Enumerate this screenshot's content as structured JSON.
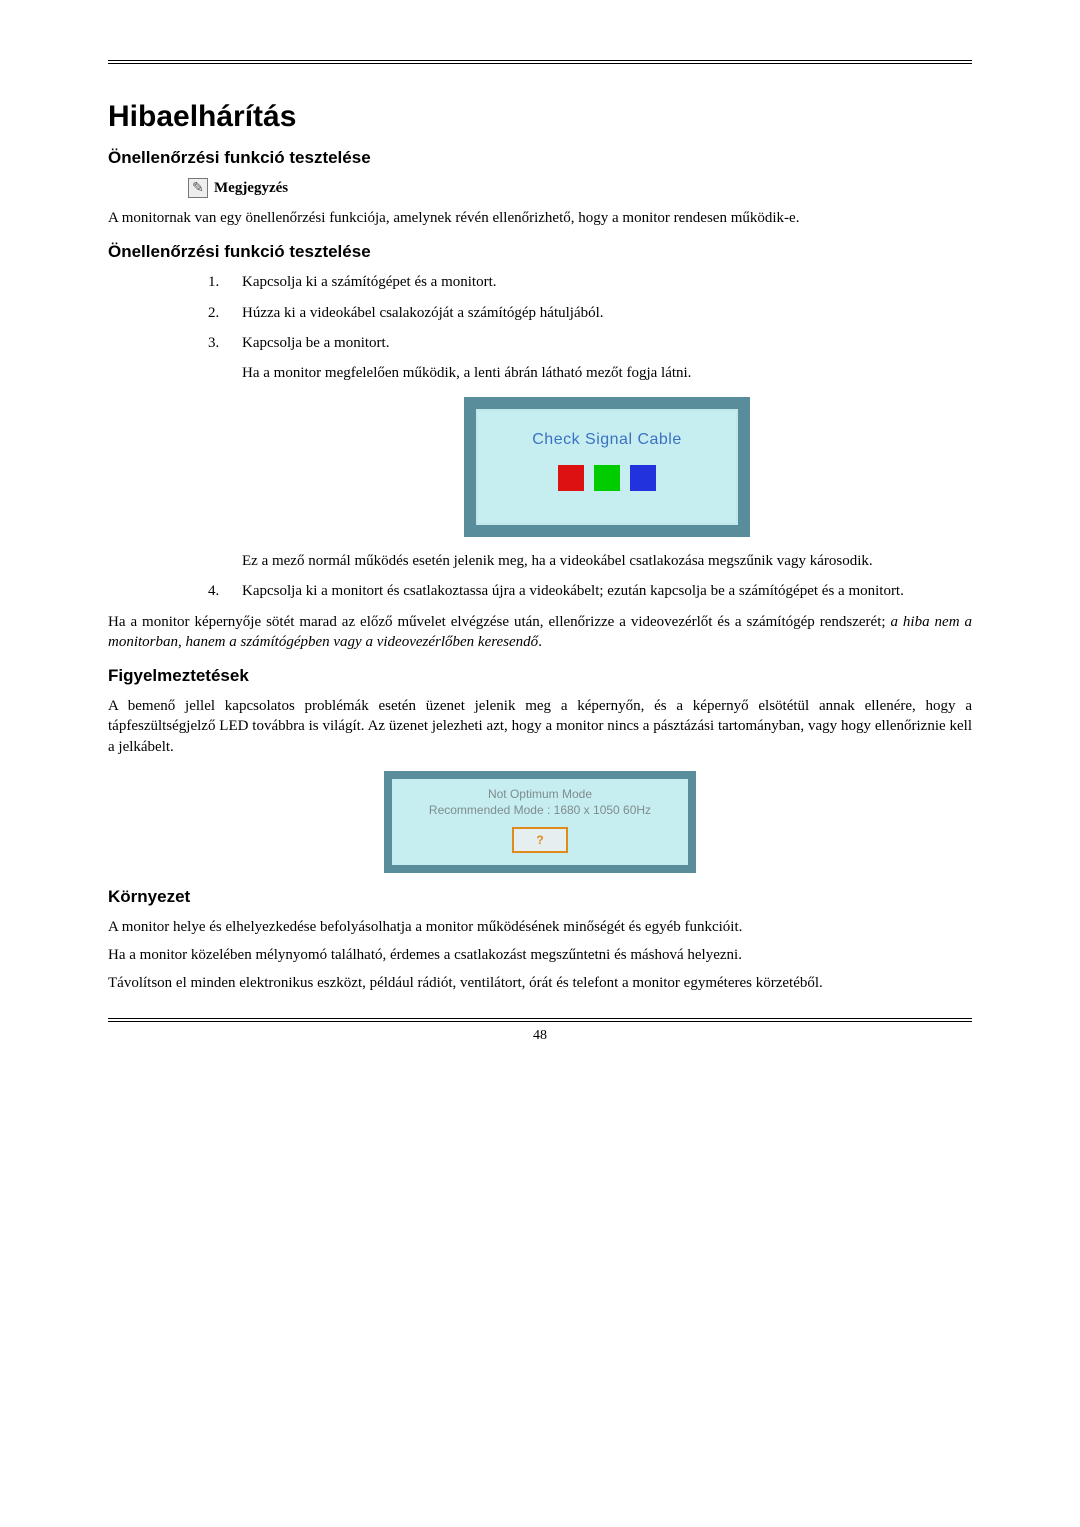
{
  "page_number": "48",
  "h1": "Hibaelhárítás",
  "self_test_heading": "Önellenőrzési funkció tesztelése",
  "note_label": "Megjegyzés",
  "note_body": "A monitornak van egy önellenőrzési funkciója, amelynek révén ellenőrizhető, hogy a monitor rendesen működik-e.",
  "steps": {
    "s1_num": "1.",
    "s1": "Kapcsolja ki a számítógépet és a monitort.",
    "s2_num": "2.",
    "s2": "Húzza ki a videokábel csalakozóját a számítógép hátuljából.",
    "s3_num": "3.",
    "s3": "Kapcsolja be a monitort.",
    "s3_sub": "Ha a monitor megfelelően működik, a lenti ábrán látható mezőt fogja látni.",
    "s3_sub2": "Ez a mező normál működés esetén jelenik meg, ha a videokábel csatlakozása megszűnik vagy károsodik.",
    "s4_num": "4.",
    "s4": "Kapcsolja ki a monitort és csatlakoztassa újra a videokábelt; ezután kapcsolja be a számítógépet és a monitort."
  },
  "after_steps_plain": "Ha a monitor képernyője sötét marad az előző művelet elvégzése után, ellenőrizze a videovezérlőt és a számítógép rendszerét; ",
  "after_steps_italic": "a hiba nem a monitorban, hanem a számítógépben vagy a videovezérlőben keresendő",
  "after_steps_dot": ".",
  "warnings_heading": "Figyelmeztetések",
  "warnings_body": "A bemenő jellel kapcsolatos problémák esetén üzenet jelenik meg a képernyőn, és a képernyő elsötétül annak ellenére, hogy a tápfeszültségjelző LED továbbra is világít. Az üzenet jelezheti azt, hogy a monitor nincs a pásztázási tartományban, vagy hogy ellenőriznie kell a jelkábelt.",
  "env_heading": "Környezet",
  "env_p1": "A monitor helye és elhelyezkedése befolyásolhatja a monitor működésének minőségét és egyéb funk­cióit.",
  "env_p2": "Ha a monitor közelében mélynyomó található, érdemes a csatlakozást megszűntetni és máshová he­lyezni.",
  "env_p3": "Távolítson el minden elektronikus eszközt, például rádiót, ventilátort, órát és telefont a monitor egy­méteres körzetéből.",
  "fig1": {
    "text": "Check Signal Cable"
  },
  "fig2": {
    "line1": "Not Optimum Mode",
    "line2": "Recommended Mode : 1680 x  1050  60Hz",
    "button": "?"
  }
}
